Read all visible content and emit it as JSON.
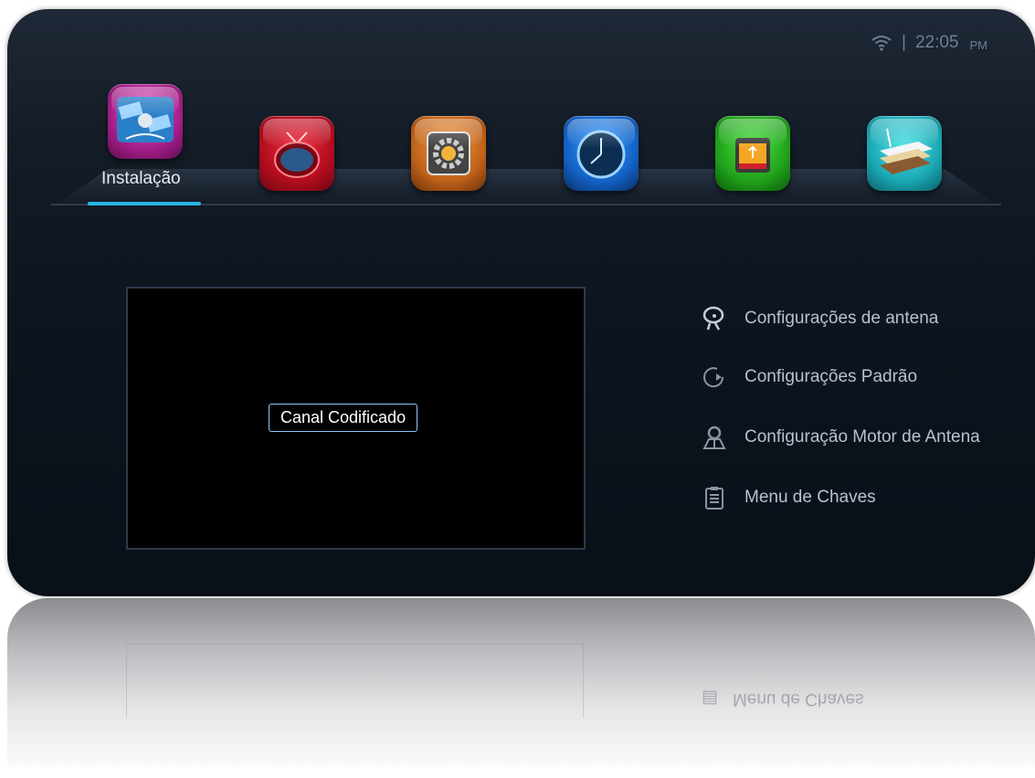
{
  "status": {
    "time": "22:05",
    "ampm": "PM",
    "separator": "|",
    "wifi_icon": "wifi-icon"
  },
  "apps": [
    {
      "name": "satellite-app",
      "icon": "satellite-icon",
      "label": "Instalação"
    },
    {
      "name": "tv-app",
      "icon": "tv-icon"
    },
    {
      "name": "settings-app",
      "icon": "gear-icon"
    },
    {
      "name": "clock-app",
      "icon": "clock-icon"
    },
    {
      "name": "usb-app",
      "icon": "usb-drive-icon"
    },
    {
      "name": "network-app",
      "icon": "router-icon"
    }
  ],
  "preview": {
    "badge": "Canal Codificado"
  },
  "menu": {
    "items": [
      {
        "label": "Configurações de antena",
        "icon": "satellite-dish-icon"
      },
      {
        "label": "Configurações Padrão",
        "icon": "reset-icon"
      },
      {
        "label": "Configuração Motor de Antena",
        "icon": "motor-location-icon"
      },
      {
        "label": "Menu de Chaves",
        "icon": "clipboard-list-icon"
      }
    ]
  },
  "reflection": {
    "menu_label": "Menu de Chaves"
  },
  "colors": {
    "accent": "#28b4e6",
    "background": "#0e1620"
  }
}
